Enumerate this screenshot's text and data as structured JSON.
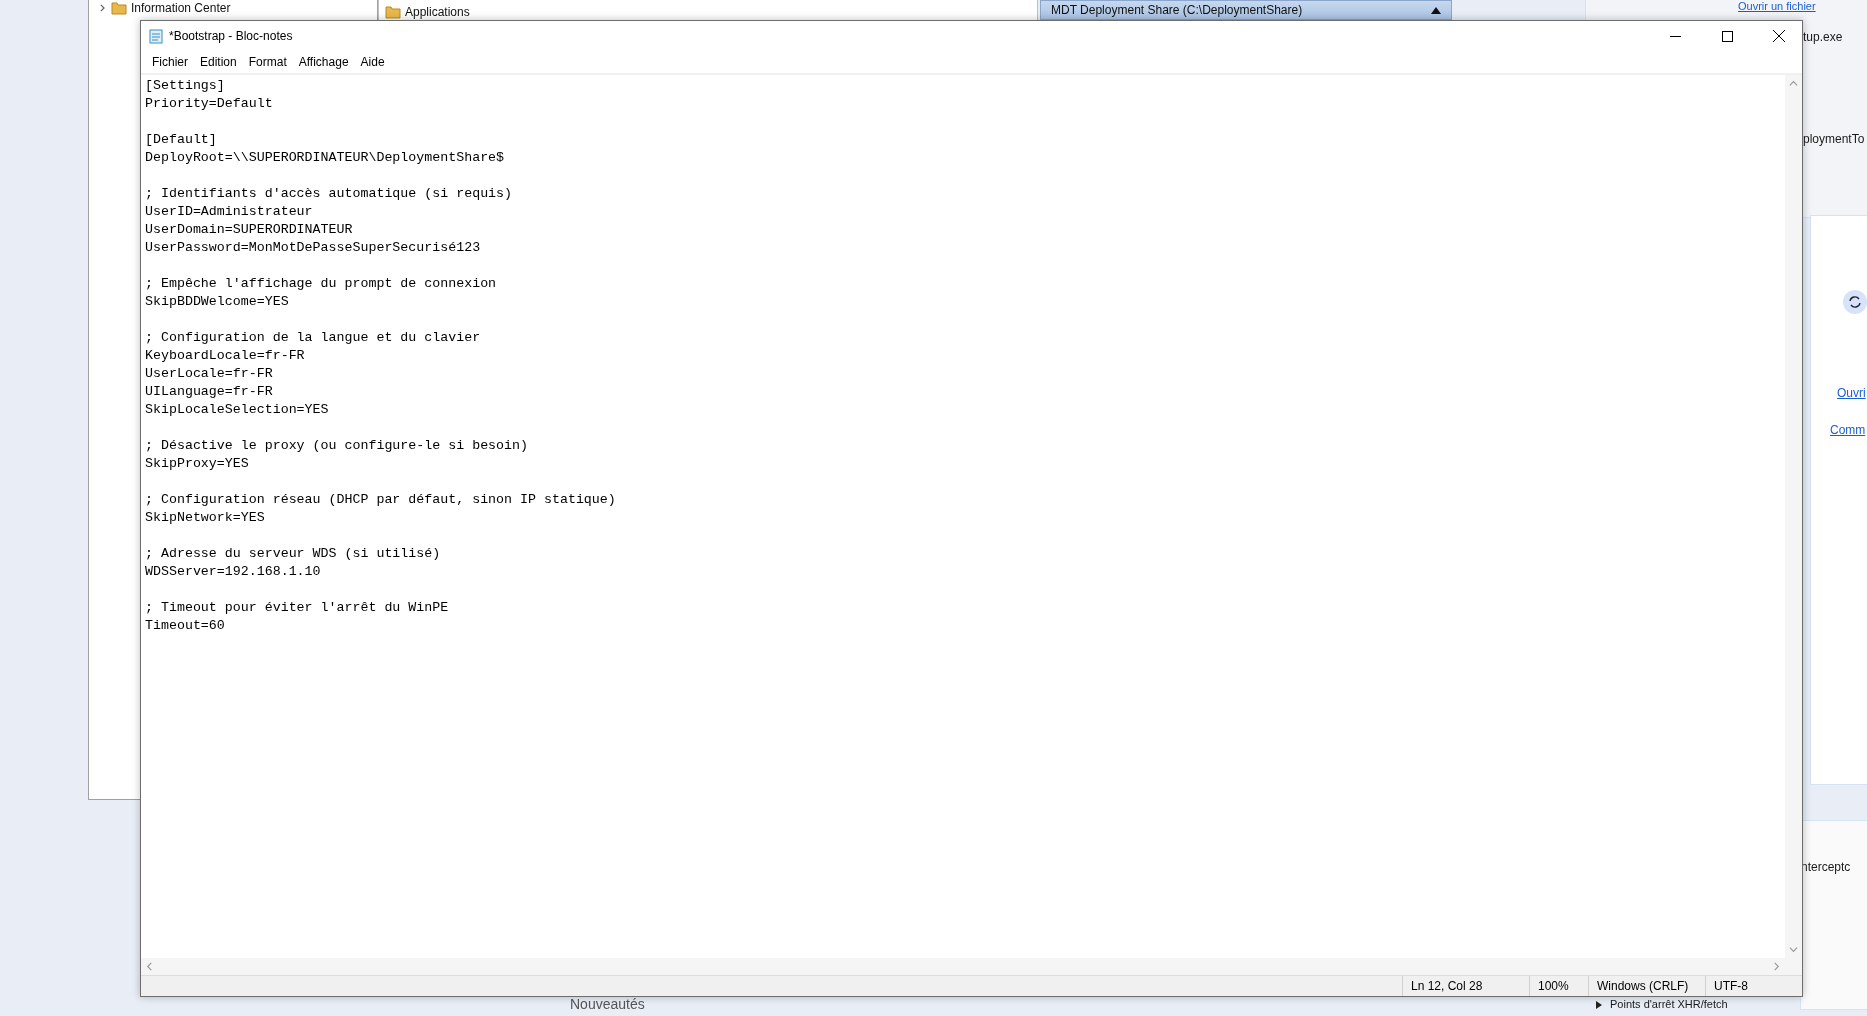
{
  "background": {
    "tree_items": [
      {
        "label": "Information Center",
        "expanded": false
      }
    ],
    "list_items": [
      "Applications"
    ],
    "section_header": {
      "label": "MDT Deployment Share (C:\\DeploymentShare)",
      "expanded": true
    },
    "side_link": "Ouvrir un fichier",
    "side_texts": [
      "tup.exe",
      "ploymentTo"
    ],
    "side_links": [
      "Ouvri",
      "Comm"
    ],
    "devtools_text": "nterceptc",
    "devtools_section": "Points d'arrêt XHR/fetch",
    "store_heading": "Nouveautés"
  },
  "notepad": {
    "title": "*Bootstrap - Bloc-notes",
    "menu": [
      "Fichier",
      "Edition",
      "Format",
      "Affichage",
      "Aide"
    ],
    "blocks": [
      [
        "[Settings]",
        "Priority=Default"
      ],
      [
        "[Default]",
        "DeployRoot=\\\\SUPERORDINATEUR\\DeploymentShare$"
      ],
      [
        "; Identifiants d'accès automatique (si requis)",
        "UserID=Administrateur",
        "UserDomain=SUPERORDINATEUR",
        "UserPassword=MonMotDePasseSuperSecurisé123"
      ],
      [
        "; Empêche l'affichage du prompt de connexion",
        "SkipBDDWelcome=YES"
      ],
      [
        "; Configuration de la langue et du clavier",
        "KeyboardLocale=fr-FR",
        "UserLocale=fr-FR",
        "UILanguage=fr-FR",
        "SkipLocaleSelection=YES"
      ],
      [
        "; Désactive le proxy (ou configure-le si besoin)",
        "SkipProxy=YES"
      ],
      [
        "; Configuration réseau (DHCP par défaut, sinon IP statique)",
        "SkipNetwork=YES"
      ],
      [
        "; Adresse du serveur WDS (si utilisé)",
        "WDSServer=192.168.1.10"
      ],
      [
        "; Timeout pour éviter l'arrêt du WinPE",
        "Timeout=60"
      ]
    ],
    "status_bar": [
      "Ln 12, Col 28",
      "100%",
      "Windows (CRLF)",
      "UTF-8"
    ]
  }
}
